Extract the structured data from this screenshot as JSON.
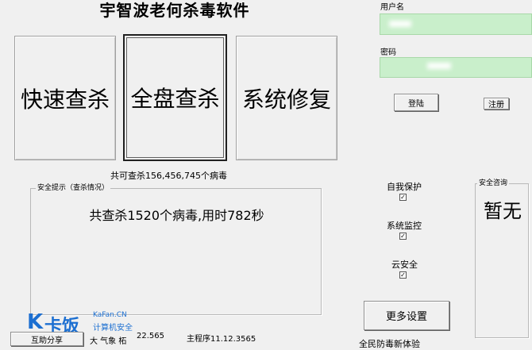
{
  "title": "宇智波老何杀毒软件",
  "main_buttons": {
    "quick_scan": "快速查杀",
    "full_scan": "全盘查杀",
    "repair": "系统修复"
  },
  "virus_db_text": "共可查杀156,456,745个病毒",
  "safety_group": {
    "legend": "安全提示（查杀情况）",
    "message": "共查杀1520个病毒,用时782秒"
  },
  "login": {
    "username_label": "用户名",
    "username_value": "",
    "password_label": "密码",
    "password_value": "",
    "login_button": "登陆",
    "register_button": "注册"
  },
  "protection": {
    "self_protect": "自我保护",
    "system_monitor": "系统监控",
    "cloud_security": "云安全"
  },
  "consult": {
    "legend": "安全咨询",
    "value": "暂无"
  },
  "more_settings": "更多设置",
  "footer": {
    "left_button": "互助分享",
    "weather": "大 气象 柘",
    "version_left": "22.565",
    "main_program": "主程序11.12.3565",
    "slogan": "全民防毒新体验"
  },
  "watermark": {
    "brand": "卡饭",
    "site": "KaFan.CN",
    "tagline": "计算机安全"
  },
  "colors": {
    "window_bg": "#f0f0f0",
    "input_bg": "#c9efcb",
    "watermark_blue": "#1c6fd1"
  }
}
